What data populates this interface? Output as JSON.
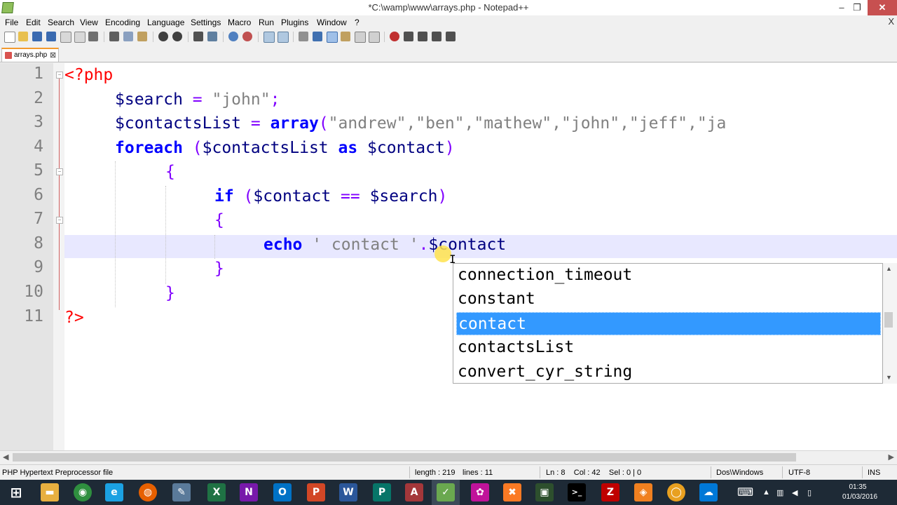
{
  "window": {
    "title": "*C:\\wamp\\www\\arrays.php - Notepad++",
    "minimize_glyph": "‒",
    "maximize_glyph": "❐",
    "close_glyph": "✕"
  },
  "menu": {
    "items": [
      "File",
      "Edit",
      "Search",
      "View",
      "Encoding",
      "Language",
      "Settings",
      "Macro",
      "Run",
      "Plugins",
      "Window",
      "?"
    ],
    "close_glyph": "X"
  },
  "tab": {
    "label": "arrays.php",
    "close_glyph": "⊠",
    "accent": "#f39a2d"
  },
  "editor": {
    "line_numbers": [
      "1",
      "2",
      "3",
      "4",
      "5",
      "6",
      "7",
      "8",
      "9",
      "10",
      "11"
    ],
    "lines": {
      "l1": {
        "php_open": "<?php"
      },
      "l2": {
        "var": "$search",
        "op1": " = ",
        "str": "\"john\"",
        "op2": ";"
      },
      "l3": {
        "var": "$contactsList",
        "op1": " = ",
        "kw": "array",
        "op2": "(",
        "str": "\"andrew\",\"ben\",\"mathew\",\"john\",\"jeff\",\"ja"
      },
      "l4": {
        "kw": "foreach",
        "op1": " (",
        "var": "$contactsList",
        "kw2": " as ",
        "var2": "$contact",
        "op2": ")"
      },
      "l5": {
        "brace": "{"
      },
      "l6": {
        "kw": "if",
        "op1": " (",
        "var": "$contact",
        "op2": " == ",
        "var2": "$search",
        "op3": ")"
      },
      "l7": {
        "brace": "{"
      },
      "l8": {
        "kw": "echo",
        "str": " ' contact '",
        "op": ".",
        "var": "$contact"
      },
      "l9": {
        "brace": "}"
      },
      "l10": {
        "brace": "}"
      },
      "l11": {
        "php_close": "?>"
      }
    },
    "caret_line": 8
  },
  "autocomplete": {
    "items": [
      "connection_timeout",
      "constant",
      "contact",
      "contactsList",
      "convert_cyr_string"
    ],
    "selected_index": 2,
    "selected_color": "#3399ff"
  },
  "statusbar": {
    "filetype": "PHP Hypertext Preprocessor file",
    "length": "length : 219",
    "lines": "lines : 11",
    "position": "Ln : 8    Col : 42    Sel : 0 | 0",
    "eol": "Dos\\Windows",
    "encoding": "UTF-8",
    "mode": "INS"
  },
  "taskbar": {
    "apps": [
      {
        "name": "start",
        "glyph": "⊞",
        "color": "#1e2a36"
      },
      {
        "name": "file-explorer",
        "glyph": "▬",
        "color": "#e8b040"
      },
      {
        "name": "chrome",
        "glyph": "◉",
        "color": "#2f8f3f"
      },
      {
        "name": "internet-explorer",
        "glyph": "e",
        "color": "#1ba1e2"
      },
      {
        "name": "firefox",
        "glyph": "◍",
        "color": "#e66000"
      },
      {
        "name": "paint",
        "glyph": "✎",
        "color": "#5a7a9a"
      },
      {
        "name": "excel",
        "glyph": "X",
        "color": "#1f7244"
      },
      {
        "name": "onenote",
        "glyph": "N",
        "color": "#7719aa"
      },
      {
        "name": "outlook",
        "glyph": "O",
        "color": "#0072c6"
      },
      {
        "name": "powerpoint",
        "glyph": "P",
        "color": "#d24726"
      },
      {
        "name": "word",
        "glyph": "W",
        "color": "#2b579a"
      },
      {
        "name": "publisher",
        "glyph": "P",
        "color": "#077568"
      },
      {
        "name": "access",
        "glyph": "A",
        "color": "#a4373a"
      },
      {
        "name": "notepad-plus-plus",
        "glyph": "✓",
        "color": "#6aa84f"
      },
      {
        "name": "app-magenta",
        "glyph": "✿",
        "color": "#c0139a"
      },
      {
        "name": "xampp",
        "glyph": "✖",
        "color": "#fb7a24"
      },
      {
        "name": "terminal",
        "glyph": "▣",
        "color": "#2d4f2d"
      },
      {
        "name": "cmd",
        "glyph": ">_",
        "color": "#000000"
      },
      {
        "name": "filezilla",
        "glyph": "Z",
        "color": "#bf0000"
      },
      {
        "name": "app-orange",
        "glyph": "◈",
        "color": "#f08020"
      },
      {
        "name": "wamp",
        "glyph": "◯",
        "color": "#e8a020"
      },
      {
        "name": "onedrive",
        "glyph": "☁",
        "color": "#0078d7"
      }
    ],
    "tray": {
      "keyboard_glyph": "⌨",
      "up_glyph": "▲",
      "network_glyph": "▥",
      "volume_glyph": "◀",
      "battery_glyph": "▯"
    },
    "time": "01:35",
    "date": "01/03/2016"
  }
}
